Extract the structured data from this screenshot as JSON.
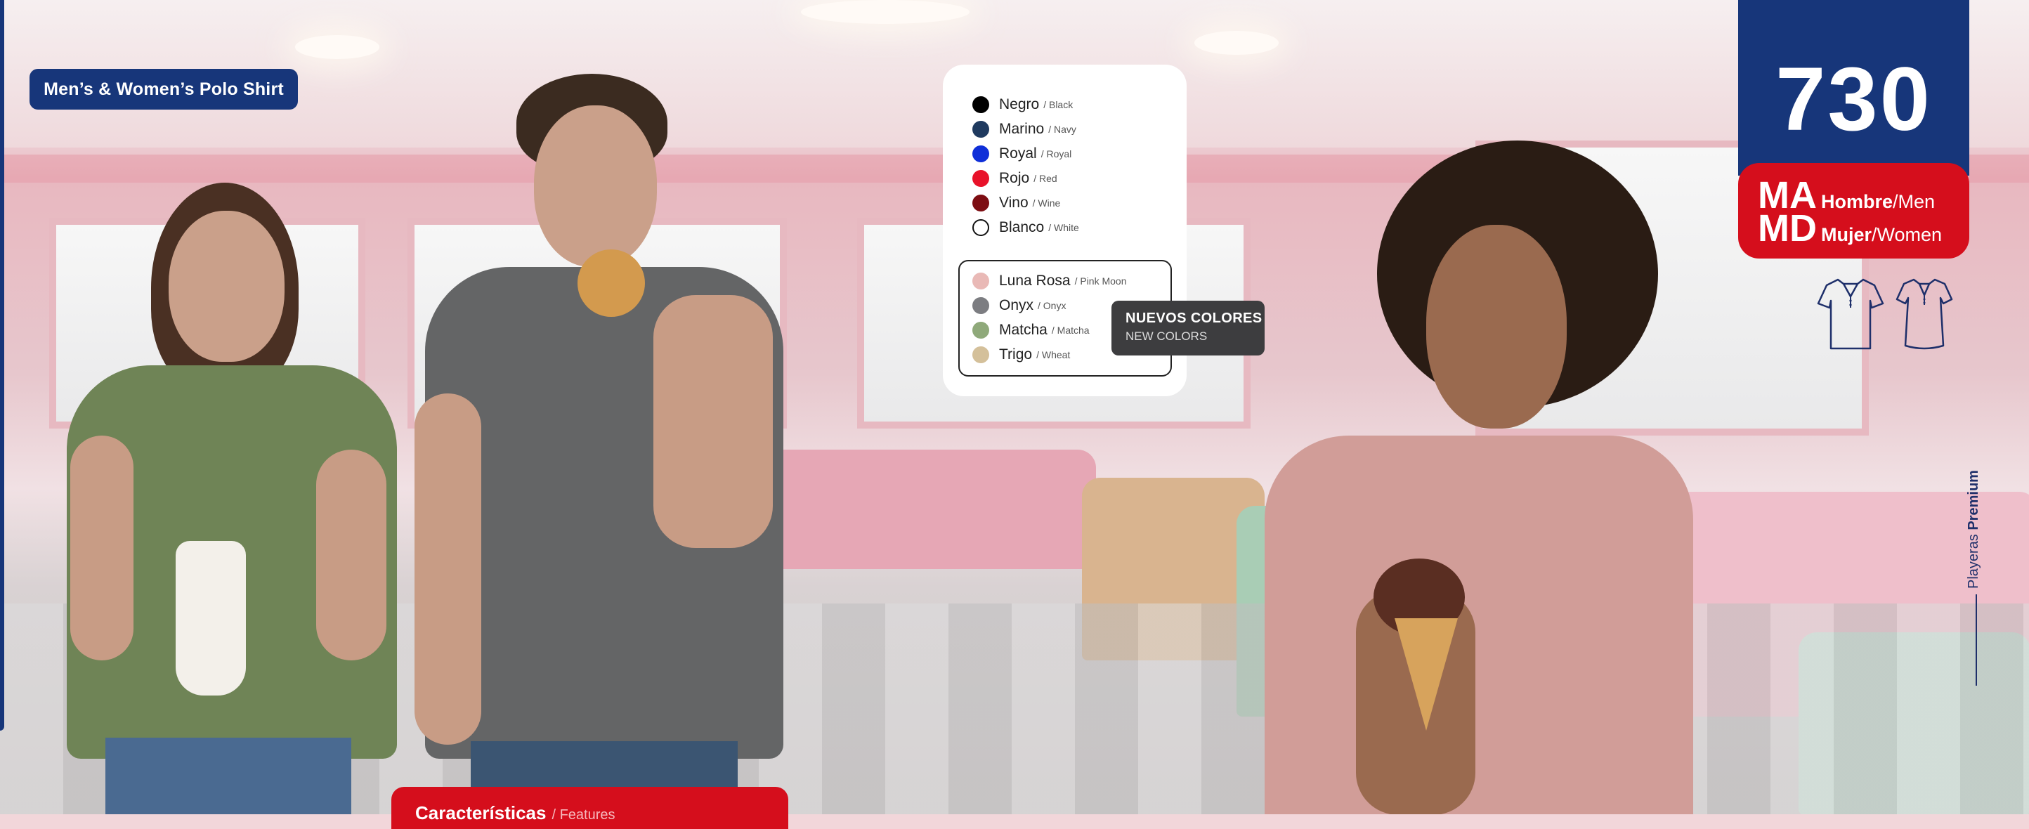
{
  "header": {
    "title": "Men’s & Women’s Polo Shirt"
  },
  "colors": {
    "standard": [
      {
        "name": "Negro",
        "sub": "/ Black",
        "hex": "#000000"
      },
      {
        "name": "Marino",
        "sub": "/ Navy",
        "hex": "#1f3a5f"
      },
      {
        "name": "Royal",
        "sub": "/ Royal",
        "hex": "#0f2fd8"
      },
      {
        "name": "Rojo",
        "sub": "/ Red",
        "hex": "#e8122a"
      },
      {
        "name": "Vino",
        "sub": "/ Wine",
        "hex": "#7d0d12"
      },
      {
        "name": "Blanco",
        "sub": "/ White",
        "hex": "#ffffff"
      }
    ],
    "new": [
      {
        "name": "Luna Rosa",
        "sub": "/ Pink Moon",
        "hex": "#e9b9b6"
      },
      {
        "name": "Onyx",
        "sub": "/ Onyx",
        "hex": "#7c7d81"
      },
      {
        "name": "Matcha",
        "sub": "/ Matcha",
        "hex": "#8fa97a"
      },
      {
        "name": "Trigo",
        "sub": "/ Wheat",
        "hex": "#d4c09a"
      }
    ],
    "new_tag": {
      "line1": "NUEVOS COLORES",
      "line2": "NEW COLORS"
    }
  },
  "model": {
    "number": "730",
    "variants": [
      {
        "code": "MA",
        "label_bold": "Hombre",
        "label_rest": "/Men"
      },
      {
        "code": "MD",
        "label_bold": "Mujer",
        "label_rest": "/Women"
      }
    ]
  },
  "side_text": {
    "regular": "Playeras ",
    "bold": "Premium"
  },
  "features": {
    "label": "Características",
    "sub": "/ Features"
  },
  "icons": [
    "polo-shirt-men-icon",
    "polo-shirt-women-icon"
  ],
  "brand_colors": {
    "navy": "#17367a",
    "red": "#d50e1c",
    "dark_tag": "#3d3d3f"
  }
}
